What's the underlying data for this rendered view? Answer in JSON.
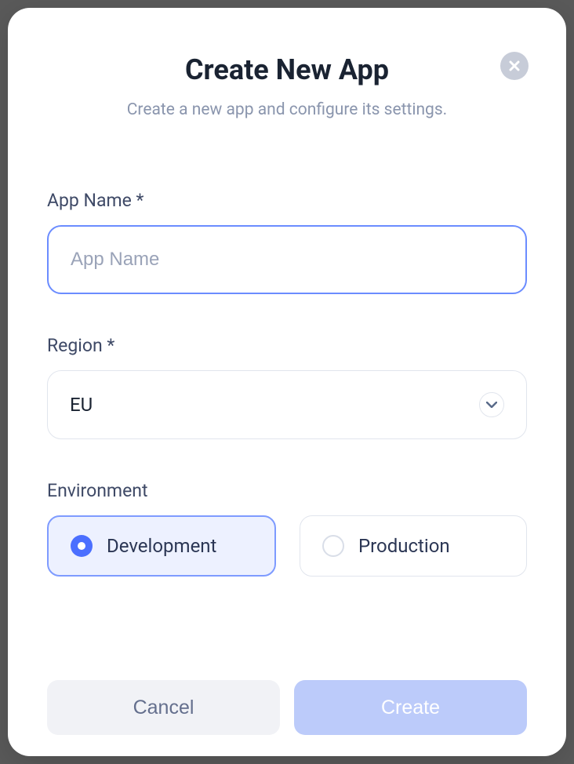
{
  "modal": {
    "title": "Create New App",
    "subtitle": "Create a new app and configure its settings."
  },
  "form": {
    "appName": {
      "label": "App Name *",
      "placeholder": "App Name",
      "value": ""
    },
    "region": {
      "label": "Region *",
      "selected": "EU"
    },
    "environment": {
      "label": "Environment",
      "options": {
        "development": "Development",
        "production": "Production"
      },
      "selected": "development"
    }
  },
  "buttons": {
    "cancel": "Cancel",
    "create": "Create"
  }
}
